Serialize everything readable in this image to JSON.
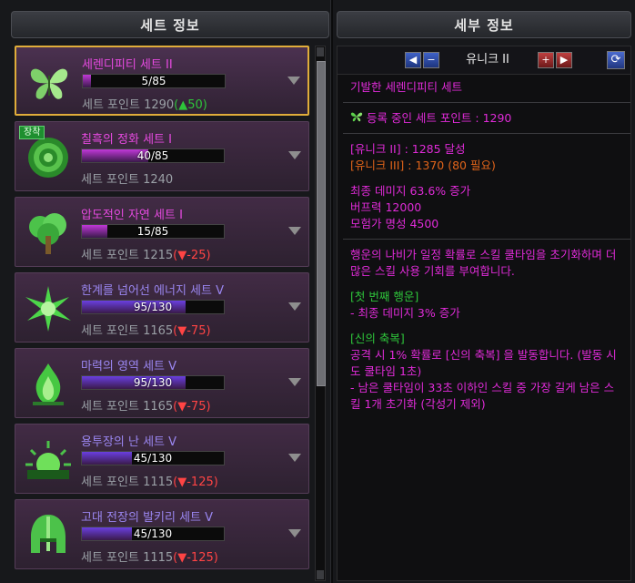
{
  "left_panel": {
    "title": "세트 정보",
    "items": [
      {
        "name": "세렌디피티 세트 II",
        "progress": "5/85",
        "ratio": 0.06,
        "points_label": "세트 포인트",
        "points": "1290",
        "delta": "(▲50)",
        "delta_color": "#2ec43a",
        "name_color": "#e64ae0",
        "fill_color": "#c038d8",
        "icon": "butterfly-icon",
        "selected": true,
        "equipped": false
      },
      {
        "name": "칠흑의 정화 세트 I",
        "progress": "40/85",
        "ratio": 0.47,
        "points_label": "세트 포인트",
        "points": "1240",
        "delta": "",
        "delta_color": "#e64ae0",
        "name_color": "#e64ae0",
        "fill_color": "#c038d8",
        "icon": "rose-icon",
        "selected": false,
        "equipped": true,
        "badge": "장착"
      },
      {
        "name": "압도적인 자연 세트 I",
        "progress": "15/85",
        "ratio": 0.18,
        "points_label": "세트 포인트",
        "points": "1215",
        "delta": "(▼-25)",
        "delta_color": "#ff4444",
        "name_color": "#e64ae0",
        "fill_color": "#c038d8",
        "icon": "tree-icon",
        "selected": false,
        "equipped": false
      },
      {
        "name": "한계를 넘어선 에너지 세트 V",
        "progress": "95/130",
        "ratio": 0.73,
        "points_label": "세트 포인트",
        "points": "1165",
        "delta": "(▼-75)",
        "delta_color": "#ff4444",
        "name_color": "#9a86f0",
        "fill_color": "#6a3fe0",
        "icon": "energy-burst-icon",
        "selected": false,
        "equipped": false
      },
      {
        "name": "마력의 영역 세트 V",
        "progress": "95/130",
        "ratio": 0.73,
        "points_label": "세트 포인트",
        "points": "1165",
        "delta": "(▼-75)",
        "delta_color": "#ff4444",
        "name_color": "#9a86f0",
        "fill_color": "#6a3fe0",
        "icon": "green-flame-icon",
        "selected": false,
        "equipped": false
      },
      {
        "name": "용투장의 난 세트 V",
        "progress": "45/130",
        "ratio": 0.35,
        "points_label": "세트 포인트",
        "points": "1115",
        "delta": "(▼-125)",
        "delta_color": "#ff4444",
        "name_color": "#9a86f0",
        "fill_color": "#6a3fe0",
        "icon": "sunrise-icon",
        "selected": false,
        "equipped": false
      },
      {
        "name": "고대 전장의 발키리 세트 V",
        "progress": "45/130",
        "ratio": 0.35,
        "points_label": "세트 포인트",
        "points": "1115",
        "delta": "(▼-125)",
        "delta_color": "#ff4444",
        "name_color": "#9a86f0",
        "fill_color": "#6a3fe0",
        "icon": "helmet-icon",
        "selected": false,
        "equipped": false
      }
    ]
  },
  "right_panel": {
    "title": "세부 정보",
    "tier_label": "유니크 II",
    "nav_prev": "◀",
    "nav_minus": "−",
    "nav_plus": "+",
    "nav_next": "▶",
    "refresh_icon": "refresh-icon",
    "set_title": "기발한 세렌디피티 세트",
    "registered_points": "등록 중인 세트 포인트 : 1290",
    "tier_req_1": "[유니크 II] : 1285 달성",
    "tier_req_2": "[유니크 III] : 1370 (80 필요)",
    "stat_1": "최종 데미지 63.6% 증가",
    "stat_2": "버프력 12000",
    "stat_3": "모험가 명성 4500",
    "desc": "행운의 나비가 일정 확률로 스킬 쿨타임을 초기화하며 더 많은 스킬 사용 기회를 부여합니다.",
    "opt1_title": "[첫 번째 행운]",
    "opt1_text": "- 최종 데미지 3% 증가",
    "opt2_title": "[신의 축복]",
    "opt2_text_1": "공격 시 1% 확률로 [신의 축복] 을 발동합니다. (발동 시도 쿨타임 1초)",
    "opt2_text_2": "- 남은 쿨타임이 33초 이하인 스킬 중 가장 길게 남은 스킬 1개 초기화 (각성기 제외)"
  }
}
